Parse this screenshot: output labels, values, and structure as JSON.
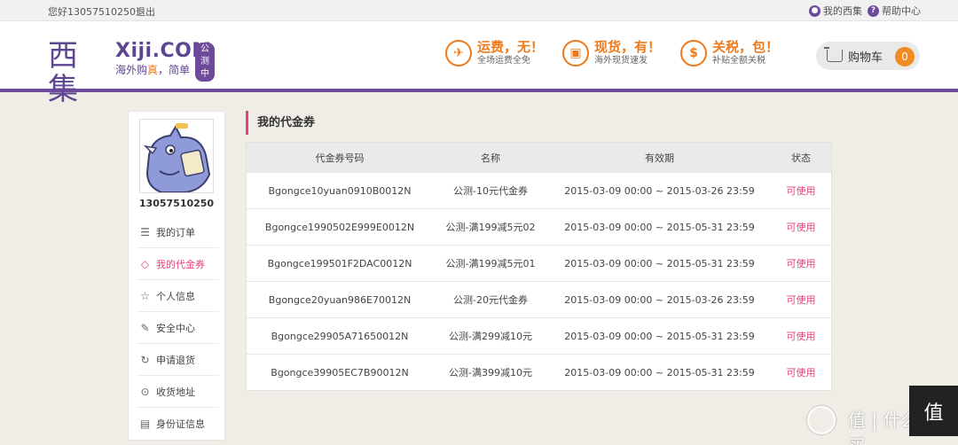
{
  "topbar": {
    "greeting": "您好13057510250！",
    "logout": "退出",
    "my_xiji": "我的西集",
    "help_center": "帮助中心"
  },
  "header": {
    "logo_cn": "西集",
    "logo_en": "Xiji.COM",
    "beta_badge": "公测中",
    "slogan_prefix": "海外购",
    "slogan_highlight": "真",
    "slogan_suffix": "，简单",
    "promos": [
      {
        "title": "运费，无！",
        "subtitle": "全场运费全免",
        "icon": "plane-icon"
      },
      {
        "title": "现货，有！",
        "subtitle": "海外现货速发",
        "icon": "box-icon"
      },
      {
        "title": "关税，包！",
        "subtitle": "补贴全额关税",
        "icon": "money-bag-icon"
      }
    ],
    "cart_label": "购物车",
    "cart_count": "0"
  },
  "sidebar": {
    "username": "13057510250",
    "items": [
      {
        "label": "我的订单",
        "icon": "order-list-icon",
        "active": false
      },
      {
        "label": "我的代金券",
        "icon": "coupon-tag-icon",
        "active": true
      },
      {
        "label": "个人信息",
        "icon": "star-icon",
        "active": false
      },
      {
        "label": "安全中心",
        "icon": "edit-icon",
        "active": false
      },
      {
        "label": "申请退货",
        "icon": "refresh-icon",
        "active": false
      },
      {
        "label": "收货地址",
        "icon": "location-pin-icon",
        "active": false
      },
      {
        "label": "身份证信息",
        "icon": "id-card-icon",
        "active": false
      }
    ]
  },
  "main": {
    "title": "我的代金券",
    "columns": [
      "代金券号码",
      "名称",
      "有效期",
      "状态"
    ],
    "rows": [
      {
        "code": "Bgongce10yuan0910B0012N",
        "name": "公测-10元代金券",
        "validity": "2015-03-09 00:00 ~ 2015-03-26 23:59",
        "status": "可使用"
      },
      {
        "code": "Bgongce1990502E999E0012N",
        "name": "公测-满199减5元02",
        "validity": "2015-03-09 00:00 ~ 2015-05-31 23:59",
        "status": "可使用"
      },
      {
        "code": "Bgongce199501F2DAC0012N",
        "name": "公测-满199减5元01",
        "validity": "2015-03-09 00:00 ~ 2015-05-31 23:59",
        "status": "可使用"
      },
      {
        "code": "Bgongce20yuan986E70012N",
        "name": "公测-20元代金券",
        "validity": "2015-03-09 00:00 ~ 2015-03-26 23:59",
        "status": "可使用"
      },
      {
        "code": "Bgongce29905A71650012N",
        "name": "公测-满299减10元",
        "validity": "2015-03-09 00:00 ~ 2015-05-31 23:59",
        "status": "可使用"
      },
      {
        "code": "Bgongce39905EC7B90012N",
        "name": "公测-满399减10元",
        "validity": "2015-03-09 00:00 ~ 2015-05-31 23:59",
        "status": "可使用"
      }
    ]
  },
  "watermark": {
    "text": "值 | 什么值得买",
    "icon": "watermark-logo-icon"
  },
  "colors": {
    "brand_purple": "#6d4b9a",
    "accent_orange": "#ee7a1b",
    "accent_pink": "#e6437c"
  }
}
